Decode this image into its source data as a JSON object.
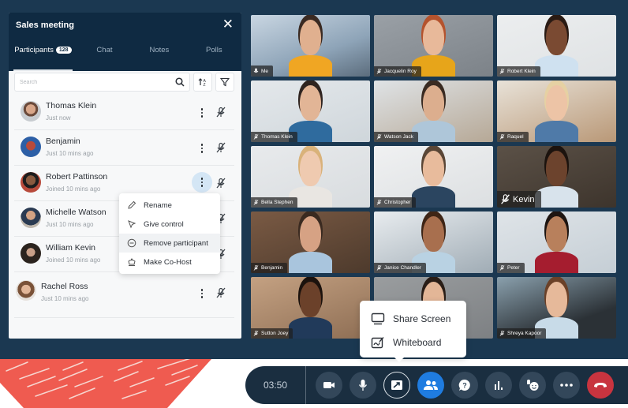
{
  "panel": {
    "title": "Sales meeting",
    "close_icon": "close-icon",
    "tabs": [
      {
        "label": "Participants",
        "badge": "128",
        "active": true
      },
      {
        "label": "Chat",
        "active": false
      },
      {
        "label": "Notes",
        "active": false
      },
      {
        "label": "Polls",
        "active": false
      }
    ],
    "search": {
      "placeholder": "Search",
      "value": ""
    },
    "participants": [
      {
        "name": "Thomas Klein",
        "status": "Just now"
      },
      {
        "name": "Benjamin",
        "status": "Just 10 mins ago"
      },
      {
        "name": "Robert Pattinson",
        "status": "Joined 10 mins ago",
        "menu_open": true
      },
      {
        "name": "Michelle Watson",
        "status": "Just 10 mins ago"
      },
      {
        "name": "William Kevin",
        "status": "Joined 10 mins ago"
      },
      {
        "name": "Rachel Ross",
        "status": "Just 10 mins ago"
      }
    ]
  },
  "context_menu": {
    "items": [
      {
        "label": "Rename",
        "icon": "pencil-icon"
      },
      {
        "label": "Give control",
        "icon": "cursor-icon"
      },
      {
        "label": "Remove participant",
        "icon": "minus-circle-icon",
        "highlighted": true
      },
      {
        "label": "Make Co-Host",
        "icon": "crown-icon"
      }
    ]
  },
  "video_tiles": [
    {
      "name": "Me",
      "mic": "on",
      "self": true
    },
    {
      "name": "Jacquelin Roy",
      "mic": "muted"
    },
    {
      "name": "Robert Klein",
      "mic": "muted"
    },
    {
      "name": "Thomas Klein",
      "mic": "muted"
    },
    {
      "name": "Watson Jack",
      "mic": "muted"
    },
    {
      "name": "Raquel",
      "mic": "muted"
    },
    {
      "name": "Bella Stephen",
      "mic": "muted"
    },
    {
      "name": "Christopher",
      "mic": "muted"
    },
    {
      "name": "Kevin",
      "mic": "muted",
      "large_label": true
    },
    {
      "name": "Benjamin",
      "mic": "muted"
    },
    {
      "name": "Janice Chandler",
      "mic": "muted"
    },
    {
      "name": "Peter",
      "mic": "muted"
    },
    {
      "name": "Sutton Joey",
      "mic": "muted"
    },
    {
      "name": "",
      "mic": "none"
    },
    {
      "name": "Shreya Kapoor",
      "mic": "muted"
    }
  ],
  "share_popup": {
    "items": [
      {
        "label": "Share Screen",
        "icon": "monitor-icon"
      },
      {
        "label": "Whiteboard",
        "icon": "whiteboard-icon"
      }
    ]
  },
  "callbar": {
    "timer": "03:50",
    "buttons": [
      {
        "name": "camera-button",
        "icon": "video-camera-icon"
      },
      {
        "name": "microphone-button",
        "icon": "microphone-icon"
      },
      {
        "name": "share-button",
        "icon": "share-screen-icon",
        "active": true
      },
      {
        "name": "participants-button",
        "icon": "people-icon",
        "highlighted": true
      },
      {
        "name": "qa-button",
        "icon": "question-bubble-icon"
      },
      {
        "name": "polls-button",
        "icon": "bar-chart-icon"
      },
      {
        "name": "reactions-button",
        "icon": "hand-smile-icon"
      },
      {
        "name": "more-button",
        "icon": "ellipsis-icon"
      },
      {
        "name": "end-call-button",
        "icon": "hang-up-icon"
      }
    ]
  },
  "colors": {
    "background": "#1b3851",
    "panel_header": "#0f2a42",
    "accent_blue": "#1f7ce0",
    "end_call_red": "#c8343f",
    "decor_coral": "#ef5b50"
  }
}
